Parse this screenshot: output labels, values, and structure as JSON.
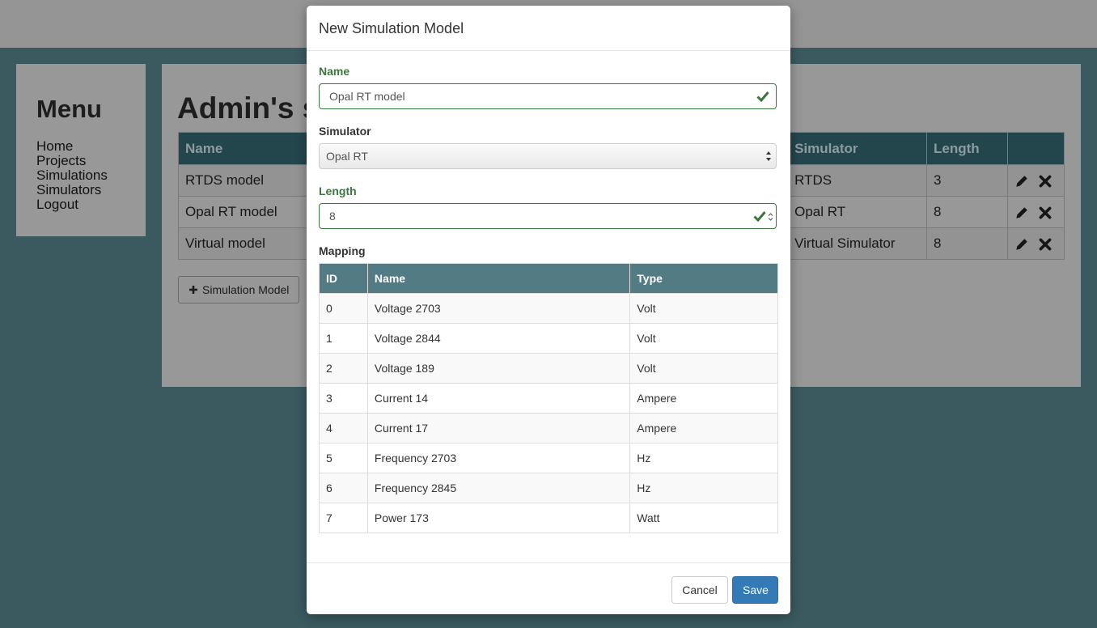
{
  "menu": {
    "title": "Menu",
    "items": [
      "Home",
      "Projects",
      "Simulations",
      "Simulators",
      "Logout"
    ]
  },
  "content": {
    "title": "Admin's s",
    "table": {
      "headers": [
        "Name",
        "Simulator",
        "Length"
      ],
      "rows": [
        {
          "name": "RTDS model",
          "simulator": "RTDS",
          "length": "3"
        },
        {
          "name": "Opal RT model",
          "simulator": "Opal RT",
          "length": "8"
        },
        {
          "name": "Virtual model",
          "simulator": "Virtual Simulator",
          "length": "8"
        }
      ]
    },
    "add_button_label": "Simulation Model"
  },
  "modal": {
    "title": "New Simulation Model",
    "name_label": "Name",
    "name_value": "Opal RT model",
    "simulator_label": "Simulator",
    "simulator_value": "Opal RT",
    "length_label": "Length",
    "length_value": "8",
    "mapping_label": "Mapping",
    "mapping": {
      "headers": [
        "ID",
        "Name",
        "Type"
      ],
      "rows": [
        {
          "id": "0",
          "name": "Voltage 2703",
          "type": "Volt"
        },
        {
          "id": "1",
          "name": "Voltage 2844",
          "type": "Volt"
        },
        {
          "id": "2",
          "name": "Voltage 189",
          "type": "Volt"
        },
        {
          "id": "3",
          "name": "Current 14",
          "type": "Ampere"
        },
        {
          "id": "4",
          "name": "Current 17",
          "type": "Ampere"
        },
        {
          "id": "5",
          "name": "Frequency 2703",
          "type": "Hz"
        },
        {
          "id": "6",
          "name": "Frequency 2845",
          "type": "Hz"
        },
        {
          "id": "7",
          "name": "Power 173",
          "type": "Watt"
        }
      ]
    },
    "cancel_label": "Cancel",
    "save_label": "Save"
  },
  "colors": {
    "accent": "#337ab7",
    "success": "#3c763d",
    "header_bg": "#527b84",
    "page_bg": "#3a5a60"
  },
  "icons": [
    "check-icon",
    "select-arrows-icon",
    "spinner-icon",
    "pencil-icon",
    "remove-icon",
    "plus-icon"
  ]
}
